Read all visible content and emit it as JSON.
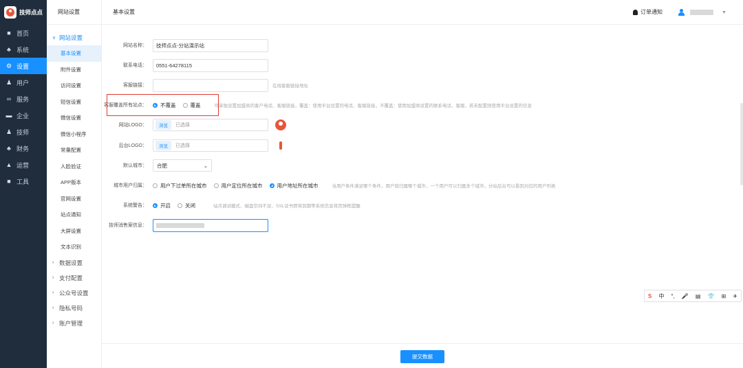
{
  "brand": {
    "name": "技师点点"
  },
  "nav": [
    {
      "label": "首页",
      "icon": "monitor-icon",
      "glyph": "■"
    },
    {
      "label": "系统",
      "icon": "sitemap-icon",
      "glyph": "♣"
    },
    {
      "label": "设置",
      "icon": "gear-icon",
      "glyph": "⚙"
    },
    {
      "label": "用户",
      "icon": "user-icon",
      "glyph": "♟"
    },
    {
      "label": "服务",
      "icon": "link-icon",
      "glyph": "∞"
    },
    {
      "label": "企业",
      "icon": "building-icon",
      "glyph": "▬"
    },
    {
      "label": "技师",
      "icon": "technician-icon",
      "glyph": "♟"
    },
    {
      "label": "财务",
      "icon": "finance-icon",
      "glyph": "♣"
    },
    {
      "label": "运营",
      "icon": "chart-icon",
      "glyph": "▲"
    },
    {
      "label": "工具",
      "icon": "toolbox-icon",
      "glyph": "■"
    }
  ],
  "submenu": {
    "header": "网站设置",
    "open_group": "网站设置",
    "items": [
      "基本设置",
      "附件设置",
      "访问设置",
      "短信设置",
      "微信设置",
      "微信小程序",
      "常量配置",
      "人脸验证",
      "APP版本",
      "官网设置",
      "站点通知",
      "大屏设置",
      "文本识别"
    ],
    "groups": [
      "数据设置",
      "支付配置",
      "公众号设置",
      "隐私号码",
      "账户管理"
    ]
  },
  "topbar": {
    "breadcrumb": "基本设置",
    "notice": "订单通知"
  },
  "form": {
    "site_name": {
      "label": "网站名称：",
      "value": "技师点点-分站演示站"
    },
    "phone": {
      "label": "联系电话：",
      "value": "0551-64278115"
    },
    "service_link": {
      "label": "客服链接：",
      "value": "",
      "hint": "在线客服链接地址"
    },
    "cover_sites": {
      "label": "客服覆盖所有站点：",
      "opt1": "不覆盖",
      "opt2": "覆盖",
      "hint": "可单独设置加盟商的客户电话、客服链接，覆盖：使用平台设置的电话、客服链接，不覆盖：使用加盟商设置的联系电话、客服，若未配置则使用平台设置的信息"
    },
    "site_logo": {
      "label": "网站LOGO：",
      "browse": "浏览",
      "status": "已选择"
    },
    "admin_logo": {
      "label": "后台LOGO：",
      "browse": "浏览",
      "status": "已选择"
    },
    "default_city": {
      "label": "默认城市：",
      "value": "合肥"
    },
    "city_belong": {
      "label": "城市用户归属：",
      "opt1": "用户下过单所在城市",
      "opt2": "用户定位所在城市",
      "opt3": "用户地址所在城市",
      "hint": "当用户条件满足哪个条件，用户就归属哪个城市，一个用户可以归属多个城市，分站后台可以看到对应的用户列表"
    },
    "warning": {
      "label": "系统警告：",
      "opt1": "开启",
      "opt2": "关闭",
      "hint": "站点调试模式、磁盘空间不足、SSL证书即将到期等系统信息将页弹框提醒"
    },
    "tech_invite": {
      "label": "技师消售案信息："
    }
  },
  "footer": {
    "submit": "提交数据"
  },
  "ime": {
    "items": [
      "S",
      "中",
      "°,",
      "🎤",
      "▤",
      "👕",
      "⊞",
      "✈"
    ]
  }
}
